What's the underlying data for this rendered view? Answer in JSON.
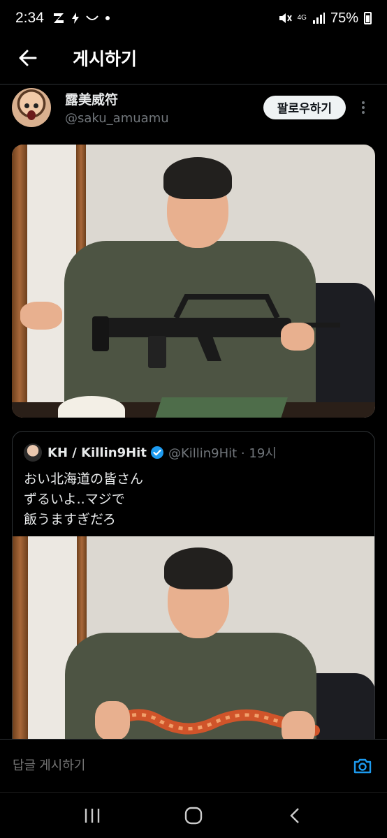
{
  "status_bar": {
    "time": "2:34",
    "network": "4G",
    "battery": "75%"
  },
  "header": {
    "title": "게시하기"
  },
  "author": {
    "name": "露美威符",
    "handle": "@saku_amuamu",
    "follow_label": "팔로우하기"
  },
  "quote": {
    "name": "KH / Killin9Hit",
    "handle": "@Killin9Hit · 19시",
    "verified": true,
    "text_lines": [
      "おい北海道の皆さん",
      "ずるいよ..マジで",
      "飯うますぎだろ"
    ]
  },
  "reply": {
    "placeholder": "답글 게시하기"
  },
  "colors": {
    "background": "#000000",
    "accent": "#1d9bf0",
    "text_primary": "#e7e9ea",
    "text_secondary": "#71767b"
  }
}
